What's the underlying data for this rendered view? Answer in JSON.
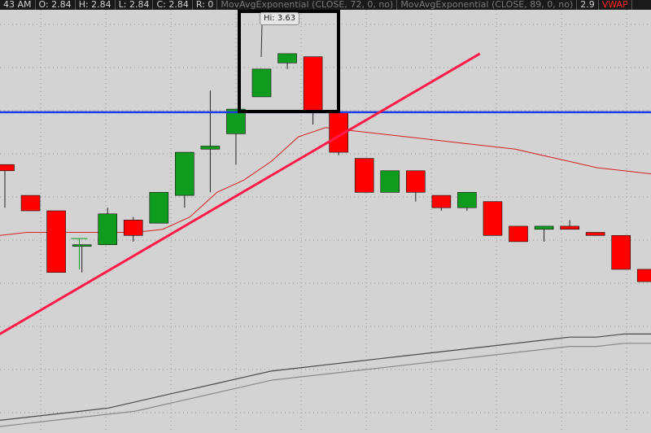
{
  "header": {
    "time_fragment": "43 AM",
    "open": "O: 2.84",
    "high": "H: 2.84",
    "low": "L: 2.84",
    "close": "C: 2.84",
    "range": "R: 0",
    "study_ema_72": "MovAvgExponential (CLOSE, 72, 0, no)",
    "study_ema_89": "MovAvgExponential (CLOSE, 89, 0, no)",
    "study_value": "2.9",
    "study_vwap": "VWAP"
  },
  "hi_label": "Hi: 3.63",
  "colors": {
    "background": "#d3d3d3",
    "grid": "#9a9a9a",
    "up_candle": "#0f9b1e",
    "down_candle": "#ff0000",
    "horizontal_line": "#1f3de0",
    "trend_line": "#ff1a4a",
    "ema_short": "#d42020",
    "ema_72": "#4a4a4a",
    "ema_89": "#8a8a8a",
    "highlight_box": "#000000"
  },
  "chart_data": {
    "type": "candlestick",
    "y_range": [
      2.42,
      3.68
    ],
    "candles": [
      {
        "open": 3.27,
        "high": 3.27,
        "low": 3.13,
        "close": 3.25
      },
      {
        "open": 3.17,
        "high": 3.17,
        "low": 3.12,
        "close": 3.12
      },
      {
        "open": 3.12,
        "high": 3.12,
        "low": 2.92,
        "close": 2.92
      },
      {
        "open": 3.01,
        "high": 3.01,
        "low": 2.92,
        "close": 3.01
      },
      {
        "open": 3.01,
        "high": 3.13,
        "low": 3.01,
        "close": 3.11
      },
      {
        "open": 3.09,
        "high": 3.1,
        "low": 3.02,
        "close": 3.04
      },
      {
        "open": 3.08,
        "high": 3.18,
        "low": 3.08,
        "close": 3.18
      },
      {
        "open": 3.17,
        "high": 3.31,
        "low": 3.13,
        "close": 3.31
      },
      {
        "open": 3.32,
        "high": 3.51,
        "low": 3.18,
        "close": 3.33
      },
      {
        "open": 3.37,
        "high": 3.44,
        "low": 3.27,
        "close": 3.45
      },
      {
        "open": 3.49,
        "high": 3.58,
        "low": 3.49,
        "close": 3.58
      },
      {
        "open": 3.6,
        "high": 3.63,
        "low": 3.58,
        "close": 3.63
      },
      {
        "open": 3.62,
        "high": 3.62,
        "low": 3.4,
        "close": 3.44
      },
      {
        "open": 3.44,
        "high": 3.44,
        "low": 3.3,
        "close": 3.31
      },
      {
        "open": 3.29,
        "high": 3.29,
        "low": 3.18,
        "close": 3.18
      },
      {
        "open": 3.18,
        "high": 3.25,
        "low": 3.18,
        "close": 3.25
      },
      {
        "open": 3.25,
        "high": 3.25,
        "low": 3.15,
        "close": 3.18
      },
      {
        "open": 3.17,
        "high": 3.17,
        "low": 3.12,
        "close": 3.13
      },
      {
        "open": 3.13,
        "high": 3.18,
        "low": 3.12,
        "close": 3.18
      },
      {
        "open": 3.15,
        "high": 3.15,
        "low": 3.04,
        "close": 3.04
      },
      {
        "open": 3.07,
        "high": 3.07,
        "low": 3.02,
        "close": 3.02
      },
      {
        "open": 3.06,
        "high": 3.06,
        "low": 3.02,
        "close": 3.07
      },
      {
        "open": 3.07,
        "high": 3.09,
        "low": 3.06,
        "close": 3.06
      },
      {
        "open": 3.05,
        "high": 3.05,
        "low": 3.04,
        "close": 3.04
      },
      {
        "open": 3.04,
        "high": 3.04,
        "low": 2.93,
        "close": 2.93
      },
      {
        "open": 2.93,
        "high": 2.93,
        "low": 2.89,
        "close": 2.89
      }
    ],
    "extra_candle_mark": {
      "index": 2.9,
      "high": 3.03,
      "low": 2.93
    },
    "horizontal_level": 3.44,
    "trend_line": {
      "from": {
        "index": -0.2,
        "value": 2.72
      },
      "to": {
        "index": 18.5,
        "value": 3.63
      }
    },
    "ema_short": [
      3.04,
      3.05,
      3.05,
      3.05,
      3.05,
      3.05,
      3.06,
      3.1,
      3.18,
      3.22,
      3.28,
      3.36,
      3.39,
      3.38,
      3.37,
      3.36,
      3.35,
      3.34,
      3.33,
      3.32,
      3.3,
      3.28,
      3.26,
      3.25,
      3.24
    ],
    "ema_72": [
      2.44,
      2.45,
      2.46,
      2.47,
      2.48,
      2.5,
      2.52,
      2.54,
      2.56,
      2.58,
      2.6,
      2.61,
      2.62,
      2.63,
      2.64,
      2.65,
      2.66,
      2.67,
      2.68,
      2.69,
      2.7,
      2.71,
      2.71,
      2.72,
      2.72
    ],
    "ema_89": [
      2.42,
      2.43,
      2.44,
      2.45,
      2.46,
      2.47,
      2.49,
      2.51,
      2.53,
      2.55,
      2.57,
      2.58,
      2.59,
      2.6,
      2.61,
      2.62,
      2.63,
      2.64,
      2.65,
      2.66,
      2.67,
      2.68,
      2.68,
      2.69,
      2.69
    ]
  }
}
